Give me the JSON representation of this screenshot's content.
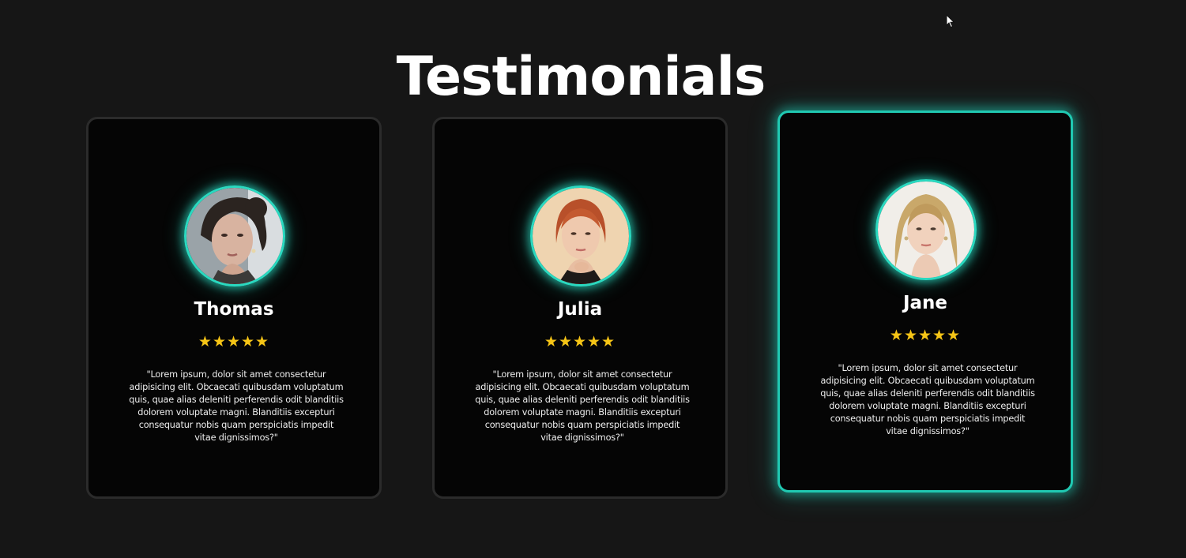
{
  "section": {
    "title": "Testimonials"
  },
  "colors": {
    "background": "#161616",
    "card": "#050505",
    "accent": "#20c9b2",
    "star": "#f6c516"
  },
  "testimonials": [
    {
      "name": "Thomas",
      "stars": "★★★★★",
      "rating": 5,
      "avatar": "person-photo",
      "quote": "\"Lorem ipsum, dolor sit amet consectetur adipisicing elit. Obcaecati quibusdam voluptatum quis, quae alias deleniti perferendis odit blanditiis dolorem voluptate magni. Blanditiis excepturi consequatur nobis quam perspiciatis impedit vitae dignissimos?\""
    },
    {
      "name": "Julia",
      "stars": "★★★★★",
      "rating": 5,
      "avatar": "person-photo",
      "quote": "\"Lorem ipsum, dolor sit amet consectetur adipisicing elit. Obcaecati quibusdam voluptatum quis, quae alias deleniti perferendis odit blanditiis dolorem voluptate magni. Blanditiis excepturi consequatur nobis quam perspiciatis impedit vitae dignissimos?\""
    },
    {
      "name": "Jane",
      "stars": "★★★★★",
      "rating": 5,
      "avatar": "person-photo",
      "quote": "\"Lorem ipsum, dolor sit amet consectetur adipisicing elit. Obcaecati quibusdam voluptatum quis, quae alias deleniti perferendis odit blanditiis dolorem voluptate magni. Blanditiis excepturi consequatur nobis quam perspiciatis impedit vitae dignissimos?\"",
      "highlighted": true
    }
  ]
}
